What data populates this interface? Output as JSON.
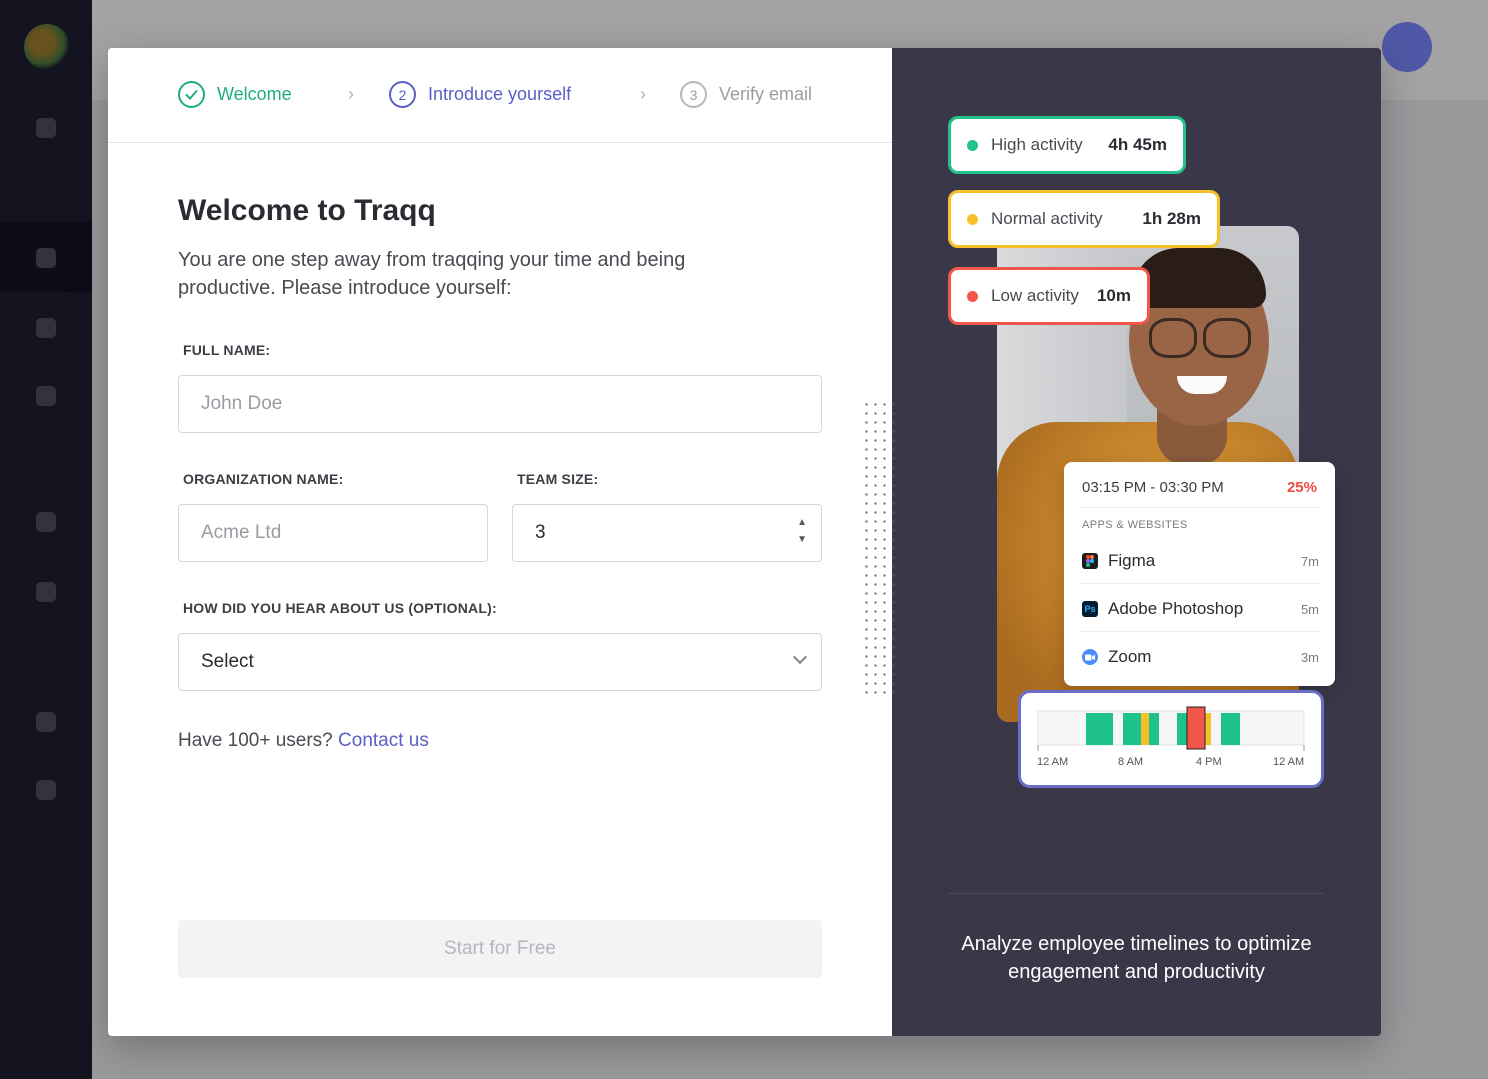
{
  "stepper": {
    "steps": [
      {
        "number": "",
        "label": "Welcome",
        "status": "completed"
      },
      {
        "number": "2",
        "label": "Introduce yourself",
        "status": "current"
      },
      {
        "number": "3",
        "label": "Verify email",
        "status": "upcoming"
      }
    ]
  },
  "form": {
    "title": "Welcome to Traqq",
    "subtitle": "You are one step away from traqqing your time and being productive. Please introduce yourself:",
    "full_name": {
      "label": "FULL NAME:",
      "placeholder": "John Doe",
      "value": ""
    },
    "organization": {
      "label": "ORGANIZATION NAME:",
      "placeholder": "Acme Ltd",
      "value": ""
    },
    "team_size": {
      "label": "TEAM SIZE:",
      "value": "3"
    },
    "referral": {
      "label": "HOW DID YOU HEAR ABOUT US (OPTIONAL):",
      "selected": "Select"
    },
    "contact_prefix": "Have 100+ users?",
    "contact_link": "Contact us",
    "submit_label": "Start for Free"
  },
  "promo": {
    "activities": [
      {
        "label": "High activity",
        "value": "4h 45m",
        "color": "#23c28a"
      },
      {
        "label": "Normal activity",
        "value": "1h 28m",
        "color": "#f5c12b"
      },
      {
        "label": "Low activity",
        "value": "10m",
        "color": "#f2554a"
      }
    ],
    "card": {
      "time_range": "03:15 PM - 03:30 PM",
      "percent": "25%",
      "apps_heading": "APPS & WEBSITES",
      "apps": [
        {
          "name": "Figma",
          "duration": "7m",
          "icon": "figma-icon"
        },
        {
          "name": "Adobe Photoshop",
          "duration": "5m",
          "icon": "photoshop-icon"
        },
        {
          "name": "Zoom",
          "duration": "3m",
          "icon": "zoom-icon"
        }
      ]
    },
    "timeline": {
      "tick_labels": [
        "12 AM",
        "8 AM",
        "4 PM",
        "12 AM"
      ]
    },
    "caption": "Analyze employee timelines to optimize engagement and productivity"
  },
  "colors": {
    "accent": "#5a5fc4",
    "success": "#1fae7a",
    "panel_bg": "#3a3848"
  }
}
